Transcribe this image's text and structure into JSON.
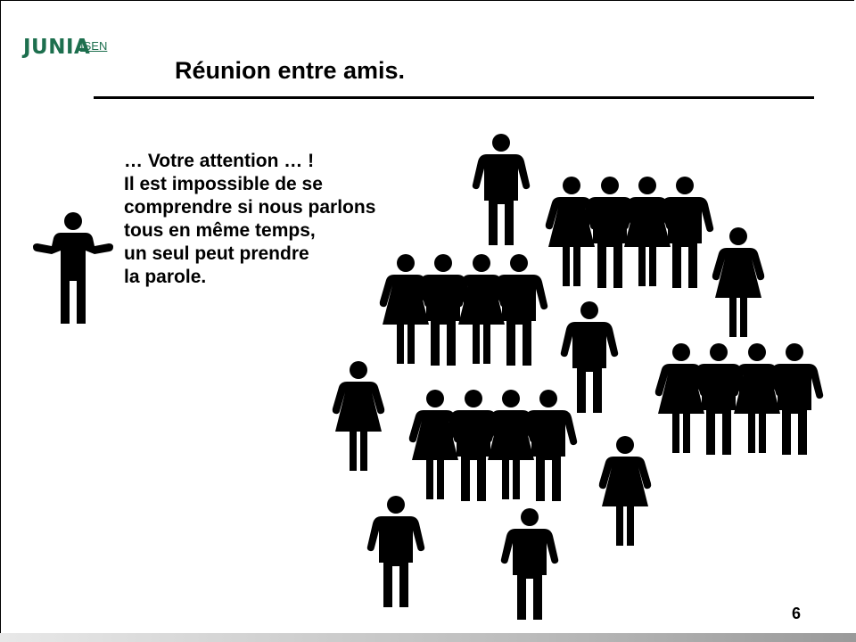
{
  "logo": {
    "brand": "JUNIA",
    "sub": "ISEN"
  },
  "slide": {
    "title": "Réunion entre amis.",
    "speech_lines": [
      "… Votre attention … !",
      "Il est impossible de se",
      "comprendre si nous parlons",
      "tous en même temps,",
      "un seul peut prendre",
      "la parole."
    ],
    "page_number": "6"
  },
  "colors": {
    "brand": "#1d6f4e",
    "text": "#000000",
    "footer": "#9a9a9a"
  },
  "icons": {
    "speaker": "person-arms-open-icon",
    "man": "man-icon",
    "woman": "woman-icon"
  }
}
